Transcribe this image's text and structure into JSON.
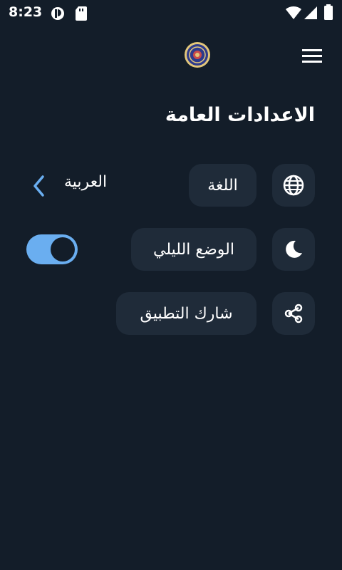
{
  "status_bar": {
    "time": "8:23"
  },
  "header": {
    "menu_icon": "hamburger-menu-icon",
    "logo": "app-logo-emblem"
  },
  "page": {
    "title": "الاعدادات العامة"
  },
  "settings": {
    "language": {
      "icon": "globe-icon",
      "label": "اللغة",
      "value": "العربية",
      "chevron": "chevron-left-icon"
    },
    "night_mode": {
      "icon": "moon-icon",
      "label": "الوضع الليلي",
      "enabled": true
    },
    "share": {
      "icon": "share-icon",
      "label": "شارك التطبيق"
    }
  },
  "colors": {
    "background": "#131d29",
    "card": "#1f2b39",
    "accent": "#6aaef0"
  }
}
